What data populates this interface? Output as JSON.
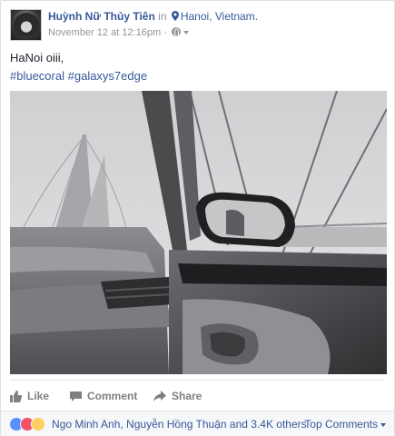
{
  "post": {
    "author": "Huỳnh Nữ Thủy Tiên",
    "in_word": "in",
    "location": "Hanoi, Vietnam.",
    "timestamp": "November 12 at 12:16pm",
    "separator": "·",
    "text": "HaNoi oiii,",
    "hashtags": [
      "#bluecoral",
      "#galaxys7edge"
    ],
    "photo_alt": "Car interior with side mirror and bridge"
  },
  "actions": {
    "like": "Like",
    "comment": "Comment",
    "share": "Share"
  },
  "reactions": {
    "icons": [
      "like-icon",
      "love-icon",
      "haha-icon"
    ],
    "summary": "Ngo Minh Anh, Nguyễn Hồng Thuận and 3.4K others",
    "sort_label": "Top Comments"
  },
  "colors": {
    "link": "#365899",
    "muted": "#90949c",
    "action": "#7f7f7f",
    "like": "#5890ff",
    "love": "#f25268",
    "haha": "#fed05f"
  }
}
